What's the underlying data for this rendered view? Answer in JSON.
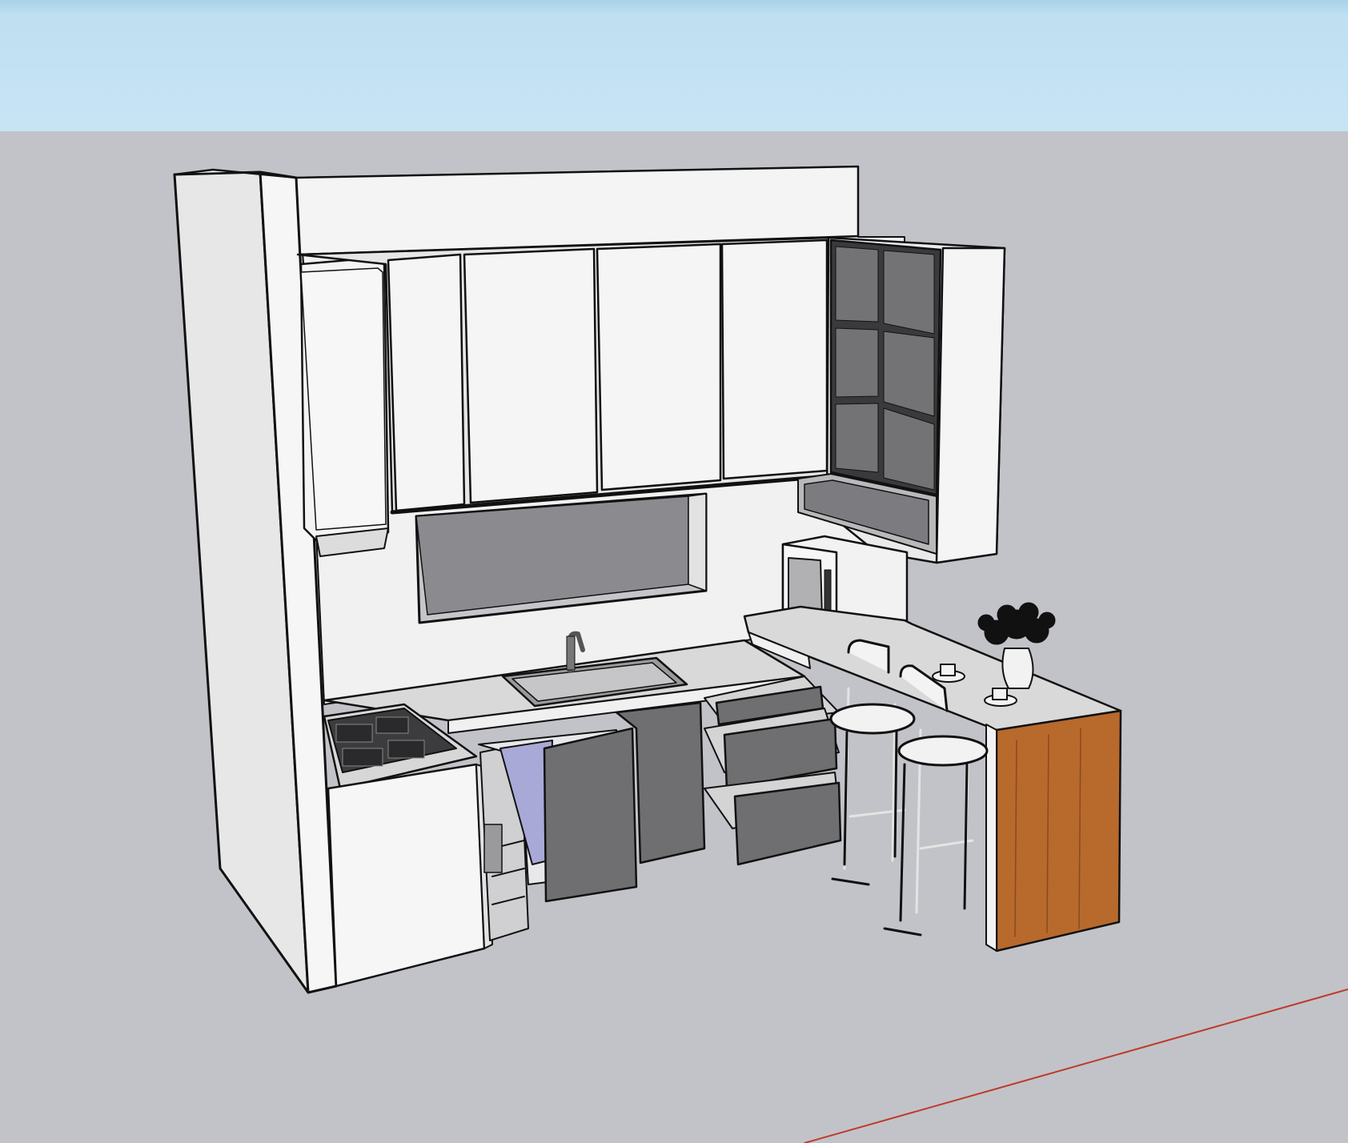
{
  "viewport": {
    "background": "sky-and-ground",
    "sky_color": "#c7e4f4",
    "ground_color": "#c2c3c8",
    "axis_color": "#c0392b"
  },
  "scene": {
    "materials": {
      "cabinet_white": "#f3f3f3",
      "cabinet_side": "#e8e8e8",
      "drawer_grey": "#6f6f72",
      "glass_grey": "#717174",
      "countertop": "#d8d8d8",
      "wood_panel": "#b5652a",
      "edge_line": "#111111"
    },
    "objects": [
      "tall-side-panel",
      "upper-wall-cabinets",
      "glass-display-cabinet",
      "range-hood",
      "window-opening",
      "sink-with-faucet",
      "gas-hob",
      "base-cabinets-open-drawers",
      "microwave",
      "breakfast-bar-wood-end",
      "bar-stools",
      "flower-vase",
      "coffee-cups"
    ]
  }
}
